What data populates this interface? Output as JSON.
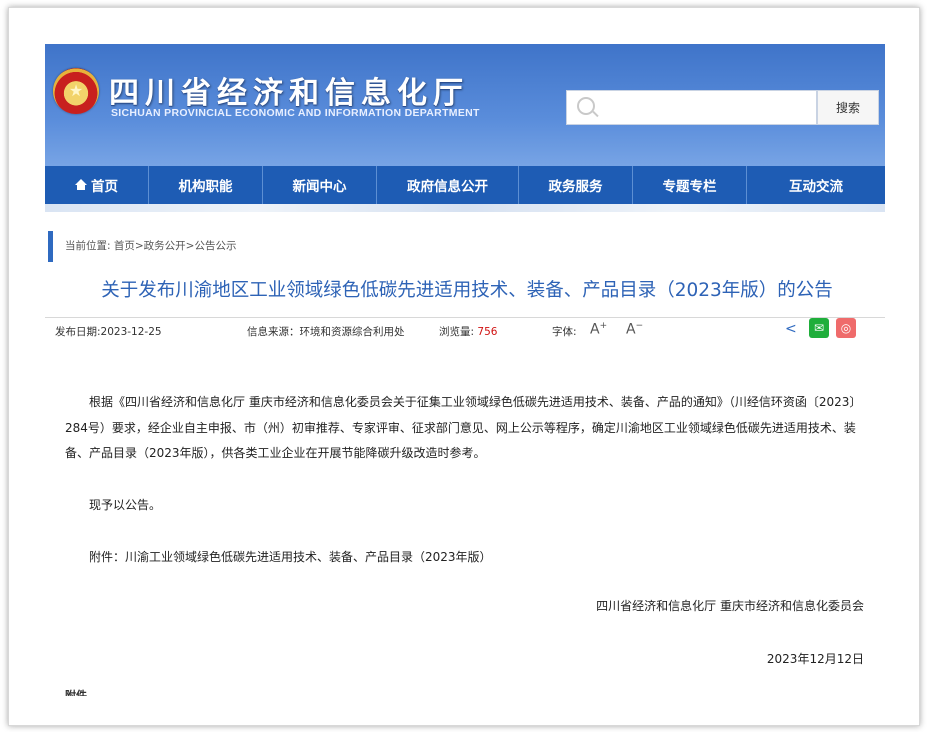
{
  "header": {
    "emblem": "emblem-icon",
    "title_cn": "四川省经济和信息化厅",
    "title_en": "SICHUAN PROVINCIAL ECONOMIC AND INFORMATION DEPARTMENT",
    "search_placeholder": "",
    "search_button": "搜索"
  },
  "nav": {
    "items": [
      {
        "label": "首页"
      },
      {
        "label": "机构职能"
      },
      {
        "label": "新闻中心"
      },
      {
        "label": "政府信息公开"
      },
      {
        "label": "政务服务"
      },
      {
        "label": "专题专栏"
      },
      {
        "label": "互动交流"
      }
    ]
  },
  "breadcrumb": "当前位置: 首页>政务公开>公告公示",
  "article": {
    "title": "关于发布川渝地区工业领域绿色低碳先进适用技术、装备、产品目录（2023年版）的公告",
    "publish_date": "发布日期:2023-12-25",
    "source": "信息来源：环境和资源综合利用处",
    "views_label": "浏览量:",
    "views": "756",
    "font_label": "字体:",
    "font_increase": "A",
    "font_decrease": "A",
    "paragraph1": "根据《四川省经济和信息化厅 重庆市经济和信息化委员会关于征集工业领域绿色低碳先进适用技术、装备、产品的通知》（川经信环资函〔2023〕284号）要求，经企业自主申报、市（州）初审推荐、专家评审、征求部门意见、网上公示等程序，确定川渝地区工业领域绿色低碳先进适用技术、装备、产品目录（2023年版），供各类工业企业在开展节能降碳升级改造时参考。",
    "paragraph2": "现予以公告。",
    "paragraph3": "附件：川渝工业领域绿色低碳先进适用技术、装备、产品目录（2023年版）",
    "signature": "四川省经济和信息化厅  重庆市经济和信息化委员会",
    "date": "2023年12月12日",
    "attachment_label": "附件"
  },
  "colors": {
    "header_blue": "#3f74c9",
    "nav_blue": "#1e5cb4",
    "title_blue": "#2e63b6",
    "views_red": "#d01010",
    "wechat_green": "#1fae3b",
    "weibo_red": "#ef6b6b"
  },
  "icons": [
    "emblem-icon",
    "search-icon",
    "home-icon",
    "share-icon",
    "wechat-icon",
    "weibo-icon"
  ]
}
